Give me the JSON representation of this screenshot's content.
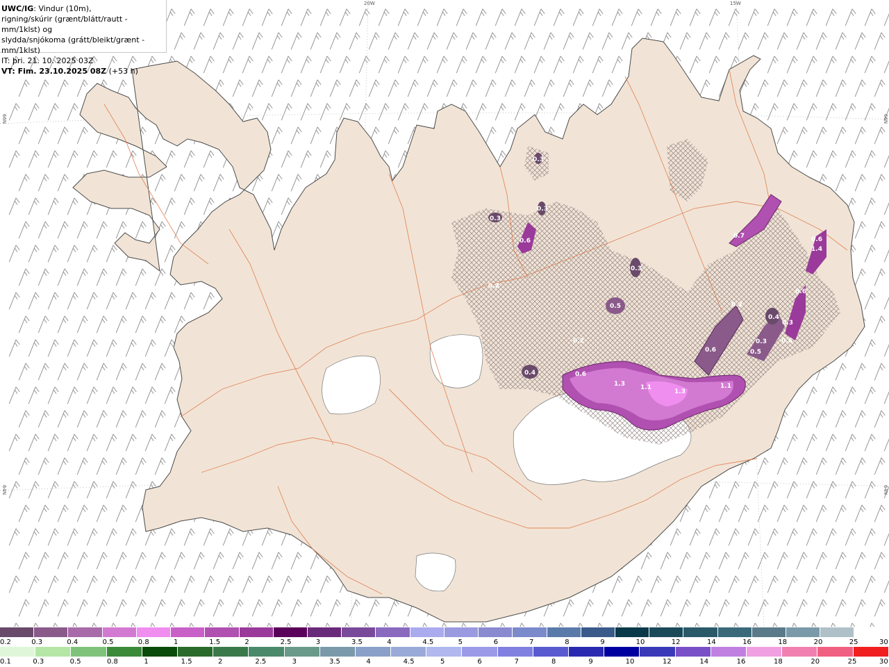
{
  "header": {
    "title_bold": "UWC/IG",
    "title_rest": ": Vindur (10m),",
    "line2": "rigning/skúrir (grænt/blátt/rautt - mm/1klst) og",
    "line3": "slydda/snjókoma (grátt/bleikt/grænt - mm/1klst)",
    "line4": "IT: þri. 21. 10. 2025 03Z",
    "line5_bold": "VT: Fim. 23.10.2025 08Z",
    "line5_rest": " (+53 h)"
  },
  "graticule": {
    "lon_20w": "20W",
    "lon_15w": "15W",
    "lat_66n_left": "66N",
    "lat_66n_right": "66N",
    "lat_64n_left": "64N",
    "lat_64n_right": "64N"
  },
  "precip_labels": [
    "0.3",
    "0.3",
    "0.6",
    "0.3",
    "0.2",
    "0.3",
    "0.5",
    "0.2",
    "0.4",
    "0.6",
    "1.3",
    "1.1",
    "1.3",
    "1.1",
    "0.6",
    "0.2",
    "0.4",
    "0.3",
    "0.3",
    "0.5",
    "0.6",
    "0.6",
    "0.6",
    "1.4",
    "0.7"
  ],
  "legend": {
    "snow": {
      "labels": [
        "0.2",
        "0.3",
        "0.4",
        "0.5",
        "0.8",
        "1",
        "1.5",
        "2",
        "2.5",
        "3",
        "3.5",
        "4",
        "4.5",
        "5",
        "6",
        "7",
        "8",
        "9",
        "10",
        "12",
        "14",
        "16",
        "18",
        "20",
        "25",
        "30"
      ],
      "colors": [
        "#6a4a6a",
        "#8a5a8a",
        "#a86aa8",
        "#d27ad2",
        "#f08ef0",
        "#c860c8",
        "#b050b0",
        "#9a3a9a",
        "#5a005a",
        "#6a2a7a",
        "#7a4a9a",
        "#8a6abf",
        "#aaaaee",
        "#9a9ae0",
        "#8a8ad0",
        "#7a8acb",
        "#5a7aaa",
        "#3a5a8a",
        "#0a3a4a",
        "#1a4a5a",
        "#2a5a6a",
        "#3a6a7a",
        "#5a7a8a",
        "#7a9aaa",
        "#b0c0c8",
        "#ffffff"
      ]
    },
    "rain": {
      "labels": [
        "0.1",
        "0.3",
        "0.5",
        "0.8",
        "1",
        "1.5",
        "2",
        "2.5",
        "3",
        "3.5",
        "4",
        "4.5",
        "5",
        "6",
        "7",
        "8",
        "9",
        "10",
        "12",
        "14",
        "16",
        "18",
        "20",
        "25",
        "30"
      ],
      "colors": [
        "#dff7d8",
        "#b6e6a6",
        "#7fc27a",
        "#3a8a3a",
        "#0a4a0a",
        "#2a6a2a",
        "#3a7a4a",
        "#4a8a6a",
        "#6a9a8a",
        "#7a9aaa",
        "#8aa0c8",
        "#9aaad8",
        "#b0b8ee",
        "#9a9ae8",
        "#8080e0",
        "#5a5ad0",
        "#2a2ab0",
        "#0000a0",
        "#3a3ab8",
        "#7a50c8",
        "#c080e0",
        "#f0a0e0",
        "#f080b0",
        "#f06080",
        "#f02020"
      ]
    }
  }
}
